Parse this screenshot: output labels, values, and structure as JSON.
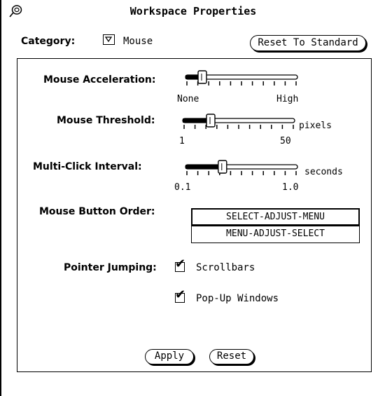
{
  "window": {
    "title": "Workspace Properties",
    "pin_icon": "pushpin-icon"
  },
  "header": {
    "category_label": "Category:",
    "category_value": "Mouse",
    "menu_icon": "menu-mark-icon",
    "reset_standard_label": "Reset To Standard"
  },
  "settings": {
    "acceleration": {
      "label": "Mouse Acceleration:",
      "min_label": "None",
      "max_label": "High",
      "level": 0.15
    },
    "threshold": {
      "label": "Mouse Threshold:",
      "min_label": "1",
      "max_label": "50",
      "unit": "pixels",
      "level": 0.25
    },
    "multiclick": {
      "label": "Multi-Click Interval:",
      "min_label": "0.1",
      "max_label": "1.0",
      "unit": "seconds",
      "level": 0.33
    },
    "button_order": {
      "label": "Mouse Button Order:",
      "options": [
        "SELECT-ADJUST-MENU",
        "MENU-ADJUST-SELECT"
      ],
      "selected": "SELECT-ADJUST-MENU"
    },
    "pointer_jumping": {
      "label": "Pointer Jumping:",
      "options": [
        {
          "label": "Scrollbars",
          "checked": true
        },
        {
          "label": "Pop-Up Windows",
          "checked": true
        }
      ]
    }
  },
  "footer": {
    "apply_label": "Apply",
    "reset_label": "Reset"
  }
}
